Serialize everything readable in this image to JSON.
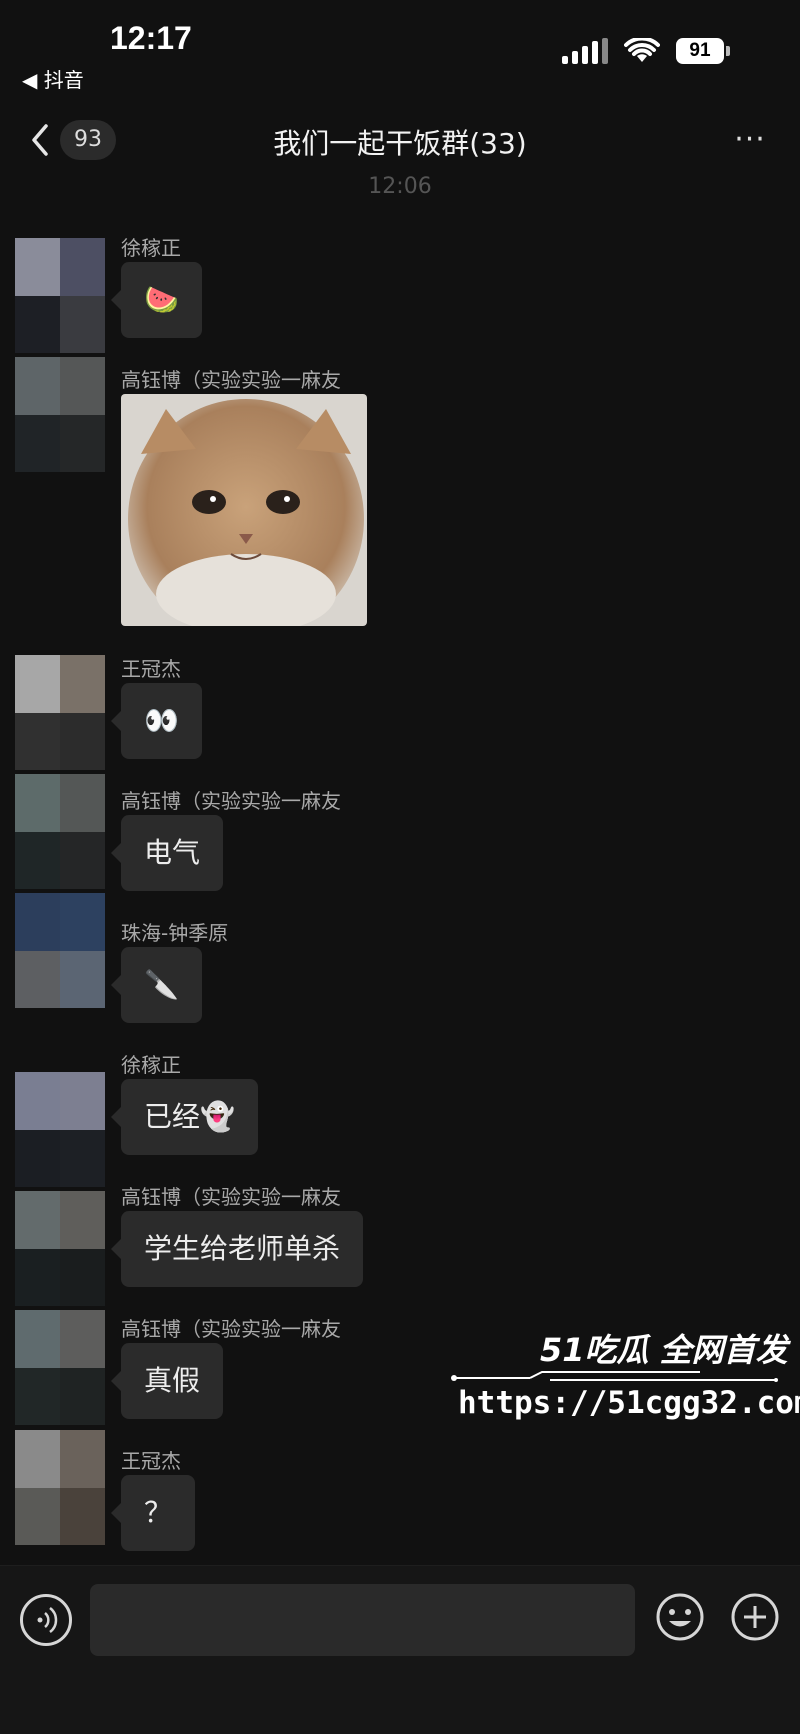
{
  "status_bar": {
    "time": "12:17",
    "back_app": "◀ 抖音",
    "battery": "91"
  },
  "header": {
    "unread_count": "93",
    "title": "我们一起干饭群(33)",
    "more": "···"
  },
  "time_divider": "12:06",
  "messages": [
    {
      "sender": "徐稼正",
      "text": "🍉",
      "avatar_colors": [
        "#8a8c9a",
        "#4d4f63",
        "#1d1f25",
        "#3a3b40"
      ]
    },
    {
      "sender": "高钰博（实验实验一麻友",
      "type": "sticker",
      "avatar_colors": [
        "#5e6568",
        "#555757",
        "#202427",
        "#252728"
      ]
    },
    {
      "sender": "王冠杰",
      "text": "👀",
      "avatar_colors": [
        "#a7a7a7",
        "#7a7168",
        "#303030",
        "#2c2c2c"
      ]
    },
    {
      "sender": "高钰博（实验实验一麻友",
      "text": "电气",
      "avatar_colors": [
        "#5d6b6a",
        "#545756",
        "#1f2627",
        "#252627"
      ]
    },
    {
      "sender": "珠海-钟季原",
      "text": "🔪",
      "avatar_colors": [
        "#2c3e5c",
        "#2d4160",
        "#5d5f62",
        "#5b6573"
      ]
    },
    {
      "sender": "徐稼正",
      "text": "已经👻",
      "avatar_colors": [
        "#7a7e92",
        "#7d7f91",
        "#1b1e23",
        "#1d2025"
      ]
    },
    {
      "sender": "高钰博（实验实验一麻友",
      "text": "学生给老师单杀",
      "avatar_colors": [
        "#636b6c",
        "#5f5e5b",
        "#1a1f21",
        "#1a1d1e"
      ]
    },
    {
      "sender": "高钰博（实验实验一麻友",
      "text": "真假",
      "avatar_colors": [
        "#5f6b6e",
        "#5d5d5c",
        "#212727",
        "#1f2323"
      ]
    },
    {
      "sender": "王冠杰",
      "text": "？",
      "avatar_colors": [
        "#8a8a8a",
        "#6a625b",
        "#5a5a57",
        "#4a423b"
      ]
    }
  ],
  "watermark": {
    "title": "51吃瓜 全网首发",
    "url": "https://51cgg32.com"
  },
  "input_bar": {
    "placeholder": ""
  }
}
